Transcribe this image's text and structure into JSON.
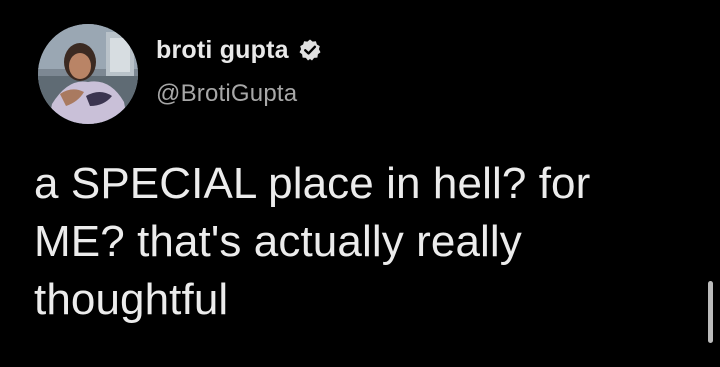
{
  "tweet": {
    "author": {
      "display_name": "broti gupta",
      "handle": "@BrotiGupta",
      "verified": true
    },
    "text": "a SPECIAL place in hell? for\nME? that's actually really\nthoughtful"
  },
  "theme": {
    "background": "#000000",
    "text_color": "#ececec",
    "handle_color": "#a7a7a7",
    "verified_badge_color": "#e0e0e0"
  },
  "icons": {
    "avatar": "profile-photo",
    "badge": "verified-check-icon"
  }
}
